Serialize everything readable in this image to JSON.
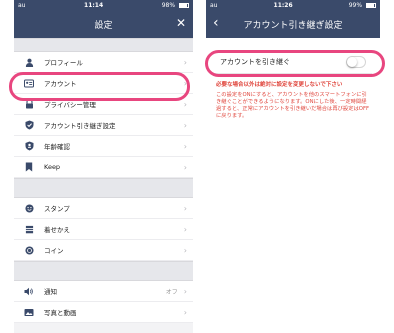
{
  "left": {
    "status": {
      "carrier": "au",
      "time": "11:14",
      "battery": "98%"
    },
    "title": "設定",
    "close_glyph": "✕",
    "groups": [
      {
        "items": [
          {
            "label": "プロフィール",
            "icon": "person-icon"
          },
          {
            "label": "アカウント",
            "icon": "account-card-icon"
          },
          {
            "label": "プライバシー管理",
            "icon": "lock-icon"
          },
          {
            "label": "アカウント引き継ぎ設定",
            "icon": "shield-check-icon"
          },
          {
            "label": "年齢確認",
            "icon": "id-badge-icon"
          },
          {
            "label": "Keep",
            "icon": "keep-icon"
          }
        ]
      },
      {
        "items": [
          {
            "label": "スタンプ",
            "icon": "smile-icon"
          },
          {
            "label": "着せかえ",
            "icon": "brush-icon"
          },
          {
            "label": "コイン",
            "icon": "coin-icon"
          }
        ]
      },
      {
        "items": [
          {
            "label": "通知",
            "icon": "speaker-icon",
            "value": "オフ"
          },
          {
            "label": "写真と動画",
            "icon": "photo-icon"
          }
        ]
      }
    ]
  },
  "right": {
    "status": {
      "carrier": "au",
      "time": "11:26",
      "battery": "99%"
    },
    "title": "アカウント引き継ぎ設定",
    "back_glyph": "‹",
    "toggle_label": "アカウントを引き継ぐ",
    "warning": "必要な場合以外は絶対に設定を変更しないで下さい",
    "description": "この設定をONにすると、アカウントを他のスマートフォンに引き継ぐことができるようになります。ONにした後、一定時間経過すると、正常にアカウントを引き継いだ場合は再び設定はOFFに戻ります。"
  },
  "colors": {
    "navbar": "#3a4a6a",
    "highlight": "#e8467f",
    "warning": "#e0473e"
  }
}
